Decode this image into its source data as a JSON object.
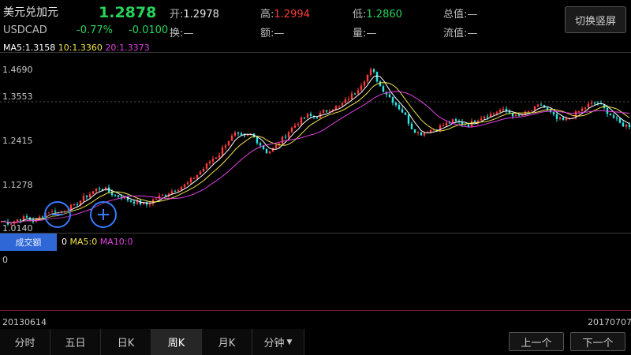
{
  "header": {
    "name": "美元兑加元",
    "code": "USDCAD",
    "price": "1.2878",
    "change_pct": "-0.77%",
    "change_abs": "-0.0100",
    "open_label": "开:",
    "open_value": "1.2978",
    "high_label": "高:",
    "high_value": "1.2994",
    "low_label": "低:",
    "low_value": "1.2860",
    "total_label": "总值:",
    "total_value": "—",
    "turnover_label": "换:",
    "turnover_value": "—",
    "amount_label": "额:",
    "amount_value": "—",
    "volume_label": "量:",
    "volume_value": "—",
    "float_label": "流值:",
    "float_value": "—"
  },
  "switch_button": "切换竖屏",
  "ma_line": {
    "ma5": "MA5:1.3158",
    "ma10": "10:1.3360",
    "ma20": "20:1.3373"
  },
  "y_axis": [
    "1.4690",
    "1.3553",
    "1.2415",
    "1.1278",
    "1.0140"
  ],
  "volume": {
    "button": "成交额",
    "value": "0",
    "ma5": "MA5:0",
    "ma10": "MA10:0",
    "zero_label": "0"
  },
  "dates": {
    "start": "20130614",
    "end": "20170707"
  },
  "tabs": [
    "分时",
    "五日",
    "日K",
    "周K",
    "月K",
    "分钟"
  ],
  "active_tab": "周K",
  "nav": {
    "prev": "上一个",
    "next": "下一个"
  },
  "colors": {
    "up": "#ff3b3b",
    "down": "#2fe6e6",
    "ma5": "#ffffff",
    "ma10": "#f2e34a",
    "ma20": "#e040e0",
    "accent": "#2f67d6"
  },
  "chart_data": {
    "type": "candlestick",
    "ylim": [
      1.014,
      1.469
    ],
    "close_series": [
      1.03,
      1.025,
      1.035,
      1.04,
      1.03,
      1.045,
      1.06,
      1.05,
      1.065,
      1.07,
      1.09,
      1.105,
      1.12,
      1.115,
      1.1,
      1.095,
      1.085,
      1.08,
      1.075,
      1.09,
      1.1,
      1.11,
      1.12,
      1.13,
      1.15,
      1.17,
      1.195,
      1.21,
      1.245,
      1.265,
      1.255,
      1.265,
      1.24,
      1.215,
      1.23,
      1.255,
      1.28,
      1.3,
      1.315,
      1.31,
      1.325,
      1.335,
      1.34,
      1.36,
      1.38,
      1.41,
      1.44,
      1.395,
      1.37,
      1.345,
      1.32,
      1.28,
      1.265,
      1.275,
      1.28,
      1.29,
      1.3,
      1.295,
      1.29,
      1.305,
      1.315,
      1.32,
      1.33,
      1.325,
      1.31,
      1.32,
      1.33,
      1.345,
      1.325,
      1.305,
      1.3,
      1.315,
      1.33,
      1.345,
      1.35,
      1.33,
      1.31,
      1.29,
      1.288
    ]
  }
}
